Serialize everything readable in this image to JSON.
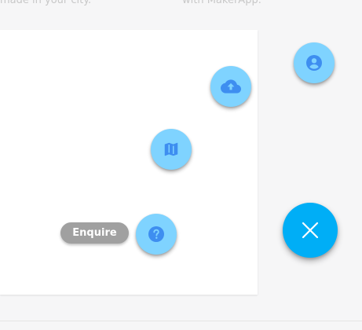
{
  "background_text": {
    "left": "made in your city.",
    "right": "with MakerApp."
  },
  "speed_dial": {
    "actions": [
      {
        "id": "profile",
        "icon": "account-circle-icon"
      },
      {
        "id": "upload",
        "icon": "cloud-upload-icon"
      },
      {
        "id": "map",
        "icon": "map-icon"
      },
      {
        "id": "enquire",
        "icon": "help-circle-icon",
        "label": "Enquire"
      }
    ],
    "main_icon": "close-icon"
  },
  "colors": {
    "mini_fab": "#7fd3ff",
    "mini_fab_icon": "#3e8ef0",
    "main_fab": "#00aef6",
    "label_bg": "#a0a0a0"
  }
}
